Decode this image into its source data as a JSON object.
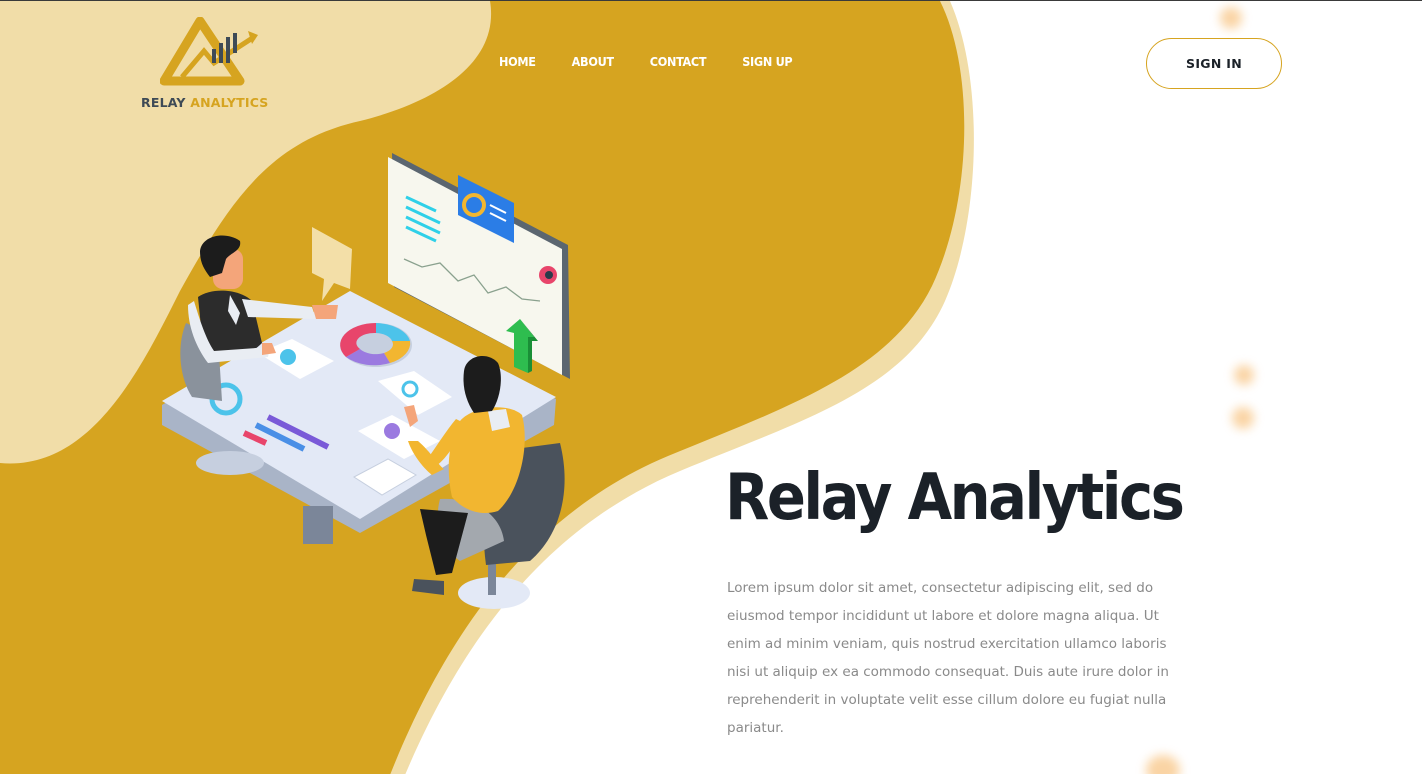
{
  "brand": {
    "name_part1": "RELAY",
    "name_part2": "ANALYTICS",
    "logo_icon": "triangle-chart-logo"
  },
  "nav": {
    "items": [
      {
        "label": "HOME"
      },
      {
        "label": "ABOUT"
      },
      {
        "label": "CONTACT"
      },
      {
        "label": "SIGN UP"
      }
    ]
  },
  "header": {
    "signin_label": "SIGN IN"
  },
  "hero": {
    "title": "Relay Analytics",
    "description": "Lorem ipsum dolor sit amet, consectetur adipiscing elit, sed do eiusmod tempor incididunt ut labore et dolore magna aliqua. Ut enim ad minim veniam, quis nostrud exercitation ullamco laboris nisi ut aliquip ex ea commodo consequat. Duis aute irure dolor in reprehenderit in voluptate velit esse cillum dolore eu fugiat nulla pariatur.",
    "illustration": "two-people-meeting-analytics-illustration"
  },
  "colors": {
    "accent": "#d6a420",
    "accent_light": "#f1dda8",
    "title": "#1b2128",
    "body_text": "#8a8a8a"
  }
}
